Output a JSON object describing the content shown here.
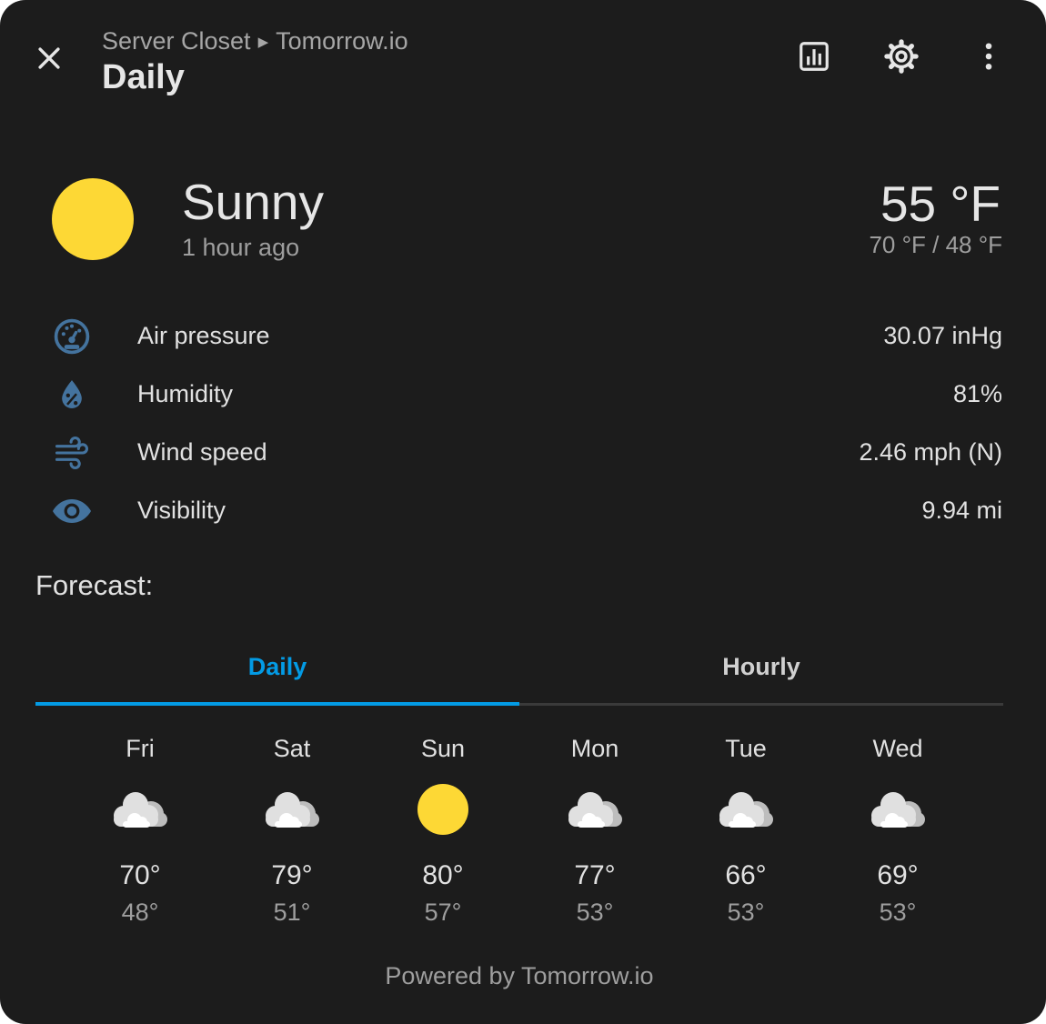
{
  "header": {
    "breadcrumb_parent": "Server Closet",
    "breadcrumb_child": "Tomorrow.io",
    "title": "Daily"
  },
  "current": {
    "condition": "Sunny",
    "icon": "sunny-icon",
    "updated": "1 hour ago",
    "temperature": "55 °F",
    "high_low": "70 °F / 48 °F"
  },
  "attributes": [
    {
      "label": "Air pressure",
      "value": "30.07 inHg",
      "icon": "gauge-icon"
    },
    {
      "label": "Humidity",
      "value": "81%",
      "icon": "water-percent-icon"
    },
    {
      "label": "Wind speed",
      "value": "2.46 mph (N)",
      "icon": "wind-icon"
    },
    {
      "label": "Visibility",
      "value": "9.94 mi",
      "icon": "eye-icon"
    }
  ],
  "forecast": {
    "heading": "Forecast:",
    "tabs": [
      "Daily",
      "Hourly"
    ],
    "active_tab": "Daily",
    "days": [
      {
        "name": "Fri",
        "condition": "cloudy",
        "high": "70°",
        "low": "48°"
      },
      {
        "name": "Sat",
        "condition": "cloudy",
        "high": "79°",
        "low": "51°"
      },
      {
        "name": "Sun",
        "condition": "sunny",
        "high": "80°",
        "low": "57°"
      },
      {
        "name": "Mon",
        "condition": "cloudy",
        "high": "77°",
        "low": "53°"
      },
      {
        "name": "Tue",
        "condition": "cloudy",
        "high": "66°",
        "low": "53°"
      },
      {
        "name": "Wed",
        "condition": "cloudy",
        "high": "69°",
        "low": "53°"
      }
    ]
  },
  "footer": {
    "attribution": "Powered by Tomorrow.io"
  },
  "colors": {
    "background": "#1c1c1c",
    "accent": "#039be5",
    "sun": "#fdd835",
    "attribute_icon": "#44739e",
    "cloud": "#d9d9d9"
  }
}
